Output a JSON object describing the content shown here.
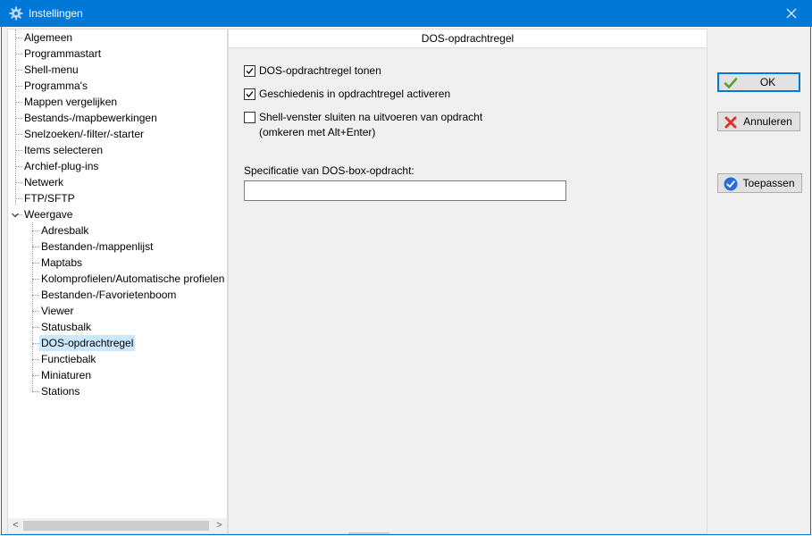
{
  "window": {
    "title": "Instellingen",
    "close_glyph": "✕",
    "icon": "gear-icon"
  },
  "tree": {
    "items": [
      {
        "label": "Algemeen",
        "level": 0
      },
      {
        "label": "Programmastart",
        "level": 0
      },
      {
        "label": "Shell-menu",
        "level": 0
      },
      {
        "label": "Programma's",
        "level": 0
      },
      {
        "label": "Mappen vergelijken",
        "level": 0
      },
      {
        "label": "Bestands-/mapbewerkingen",
        "level": 0
      },
      {
        "label": "Snelzoeken/-filter/-starter",
        "level": 0
      },
      {
        "label": "Items selecteren",
        "level": 0
      },
      {
        "label": "Archief-plug-ins",
        "level": 0
      },
      {
        "label": "Netwerk",
        "level": 0
      },
      {
        "label": "FTP/SFTP",
        "level": 0
      },
      {
        "label": "Weergave",
        "level": 0,
        "expanded": true
      },
      {
        "label": "Adresbalk",
        "level": 1
      },
      {
        "label": "Bestanden-/mappenlijst",
        "level": 1
      },
      {
        "label": "Maptabs",
        "level": 1
      },
      {
        "label": "Kolomprofielen/Automatische profielen",
        "level": 1
      },
      {
        "label": "Bestanden-/Favorietenboom",
        "level": 1
      },
      {
        "label": "Viewer",
        "level": 1
      },
      {
        "label": "Statusbalk",
        "level": 1
      },
      {
        "label": "DOS-opdrachtregel",
        "level": 1,
        "selected": true
      },
      {
        "label": "Functiebalk",
        "level": 1
      },
      {
        "label": "Miniaturen",
        "level": 1
      },
      {
        "label": "Stations",
        "level": 1
      }
    ],
    "scroll_left_glyph": "<",
    "scroll_right_glyph": ">"
  },
  "panel": {
    "header": "DOS-opdrachtregel",
    "checkboxes": [
      {
        "label": "DOS-opdrachtregel tonen",
        "checked": true
      },
      {
        "label": "Geschiedenis in opdrachtregel activeren",
        "checked": true
      },
      {
        "label": "Shell-venster sluiten na uitvoeren van opdracht",
        "sublabel": "(omkeren met Alt+Enter)",
        "checked": false
      }
    ],
    "dosbox_label": "Specificatie van DOS-box-opdracht:",
    "dosbox_value": ""
  },
  "buttons": {
    "ok": "OK",
    "cancel": "Annuleren",
    "apply": "Toepassen"
  },
  "colors": {
    "titlebar": "#0078d7",
    "selection": "#cce8ff",
    "ok_check": "#5a9e2e",
    "cancel_x": "#e0312b",
    "apply_circle": "#2b6cd8"
  }
}
